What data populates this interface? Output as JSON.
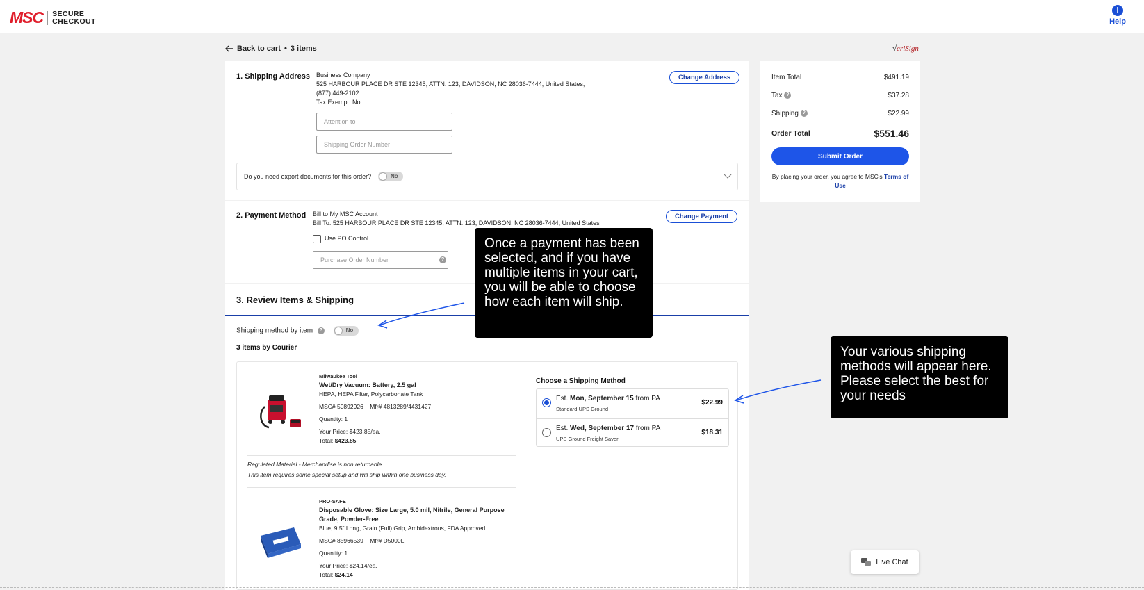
{
  "header": {
    "brand": "MSC",
    "secure_line1": "SECURE",
    "secure_line2": "CHECKOUT",
    "help_label": "Help",
    "help_icon": "i"
  },
  "back": {
    "label": "Back to cart",
    "separator": "•",
    "count": "3 items"
  },
  "verisign": {
    "mark": "√",
    "text": "eriSign"
  },
  "shipping_address": {
    "title": "1. Shipping Address",
    "company": "Business Company",
    "address": "525 HARBOUR PLACE DR STE 12345, ATTN: 123, DAVIDSON, NC 28036-7444, United States,",
    "phone": "(877) 449-2102",
    "tax_exempt": "Tax Exempt: No",
    "change_label": "Change Address",
    "attention_placeholder": "Attention to",
    "order_number_placeholder": "Shipping Order Number",
    "export_question": "Do you need export documents for this order?",
    "export_toggle": "No"
  },
  "payment": {
    "title": "2. Payment Method",
    "method": "Bill to My MSC Account",
    "bill_to": "Bill To: 525 HARBOUR PLACE DR STE 12345, ATTN: 123, DAVIDSON, NC 28036-7444, United States",
    "change_label": "Change Payment",
    "po_control_label": "Use PO Control",
    "po_placeholder": "Purchase Order Number",
    "help_glyph": "?"
  },
  "review": {
    "title": "3. Review Items & Shipping",
    "method_by_item": "Shipping method by item",
    "method_toggle": "No",
    "items_by": "3 items by Courier",
    "choose_label": "Choose a Shipping Method",
    "items": [
      {
        "brand": "Milwaukee Tool",
        "name": "Wet/Dry Vacuum: Battery, 2.5 gal",
        "desc": "HEPA, HEPA Filter, Polycarbonate Tank",
        "msc": "MSC# 50892926",
        "mfr": "Mfr# 4813289/4431427",
        "qty": "Quantity:  1",
        "price": "Your Price: $423.85/ea.",
        "total_label": "Total: ",
        "total": "$423.85",
        "note1": "Regulated Material - Merchandise is non returnable",
        "note2": "This item requires some special setup and will ship within one business day."
      },
      {
        "brand": "PRO-SAFE",
        "name": "Disposable Glove: Size Large, 5.0 mil, Nitrile, General Purpose Grade, Powder-Free",
        "desc": "Blue, 9.5\" Long, Grain (Full) Grip, Ambidextrous, FDA Approved",
        "msc": "MSC# 85966539",
        "mfr": "Mfr# D5000L",
        "qty": "Quantity:  1",
        "price": "Your Price: $24.14/ea.",
        "total_label": "Total: ",
        "total": "$24.14"
      }
    ],
    "options": [
      {
        "est": "Est. ",
        "day": "Mon, September 15",
        "from": " from PA",
        "service": "Standard UPS Ground",
        "price": "$22.99",
        "selected": true
      },
      {
        "est": "Est. ",
        "day": "Wed, September 17",
        "from": " from PA",
        "service": "UPS Ground Freight Saver",
        "price": "$18.31",
        "selected": false
      }
    ]
  },
  "summary": {
    "item_total_label": "Item Total",
    "item_total": "$491.19",
    "tax_label": "Tax",
    "tax": "$37.28",
    "shipping_label": "Shipping",
    "shipping": "$22.99",
    "order_total_label": "Order Total",
    "order_total": "$551.46",
    "submit_label": "Submit Order",
    "agree_text": "By placing your order, you agree to MSC's ",
    "terms_label": "Terms of Use"
  },
  "callouts": {
    "payment": "Once a payment has been selected, and if you have multiple items in your cart, you will be able to choose how each item will ship.",
    "shipping": "Your various shipping methods will appear here. Please select the best for your needs"
  },
  "chat": {
    "label": "Live Chat"
  },
  "colors": {
    "brand_red": "#e01e2b",
    "accent_blue": "#1e55e8",
    "link_blue": "#1a3fa8"
  }
}
